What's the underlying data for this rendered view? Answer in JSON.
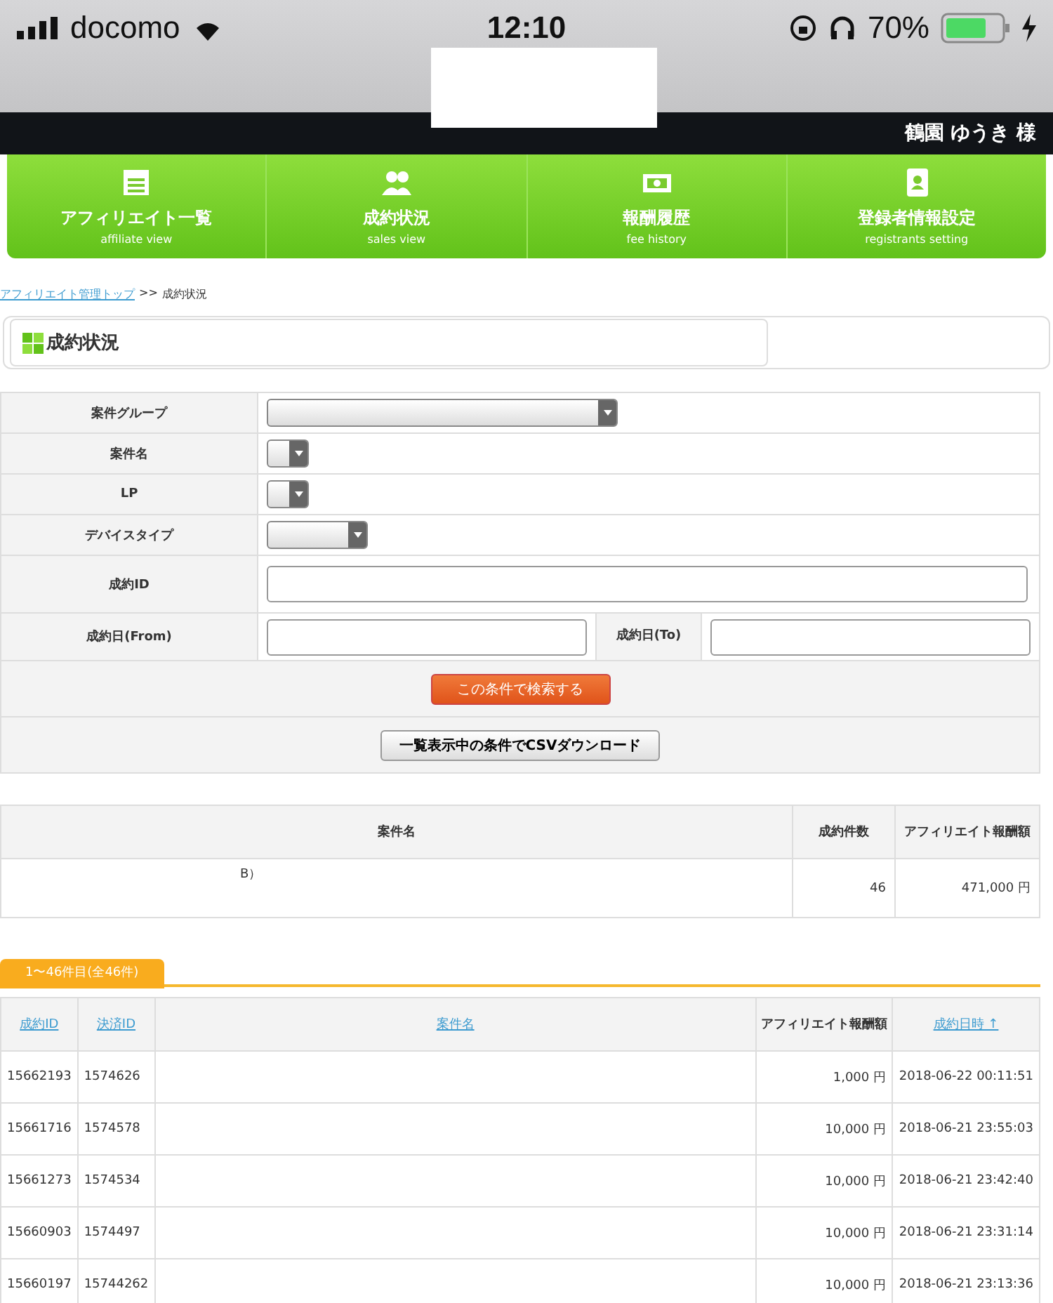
{
  "status_bar": {
    "carrier": "docomo",
    "time": "12:10",
    "battery": "70%"
  },
  "header": {
    "user_name": "鶴園 ゆうき 様"
  },
  "nav": [
    {
      "label": "アフィリエイト一覧",
      "sublabel": "affiliate view"
    },
    {
      "label": "成約状況",
      "sublabel": "sales view"
    },
    {
      "label": "報酬履歴",
      "sublabel": "fee history"
    },
    {
      "label": "登録者情報設定",
      "sublabel": "registrants setting"
    }
  ],
  "breadcrumb": {
    "link": "アフィリエイト管理トップ",
    "separator": ">>",
    "current": "成約状況"
  },
  "page_title": "成約状況",
  "form": {
    "rows": [
      {
        "kind": "select_wide",
        "label": "案件グループ"
      },
      {
        "kind": "select_tiny",
        "label": "案件名"
      },
      {
        "kind": "select_tiny",
        "label": "LP"
      },
      {
        "kind": "select_small",
        "label": "デバイスタイプ"
      },
      {
        "kind": "input",
        "label": "成約ID"
      },
      {
        "kind": "date_range",
        "label": "成約日(From)",
        "label_to": "成約日(To)"
      }
    ],
    "search_button": "この条件で検索する",
    "csv_button": "一覧表示中の条件でCSVダウンロード"
  },
  "summary": {
    "columns": [
      "案件名",
      "成約件数",
      "アフィリエイト報酬額"
    ],
    "rows": [
      [
        "B）",
        "46",
        "471,000 円"
      ]
    ]
  },
  "page_tab": "1〜46件目(全46件)",
  "results": {
    "columns": [
      {
        "label": "成約ID",
        "link": true
      },
      {
        "label": "決済ID",
        "link": true
      },
      {
        "label": "案件名",
        "link": true
      },
      {
        "label": "アフィリエイト報酬額",
        "link": false
      },
      {
        "label": "成約日時 ↑",
        "link": true
      }
    ],
    "rows": [
      [
        "15662193",
        "1574626",
        "",
        "1,000 円",
        "2018-06-22 00:11:51"
      ],
      [
        "15661716",
        "1574578",
        "",
        "10,000 円",
        "2018-06-21 23:55:03"
      ],
      [
        "15661273",
        "1574534",
        "",
        "10,000 円",
        "2018-06-21 23:42:40"
      ],
      [
        "15660903",
        "1574497",
        "",
        "10,000 円",
        "2018-06-21 23:31:14"
      ],
      [
        "15660197",
        "15744262",
        "",
        "10,000 円",
        "2018-06-21 23:13:36"
      ]
    ]
  }
}
